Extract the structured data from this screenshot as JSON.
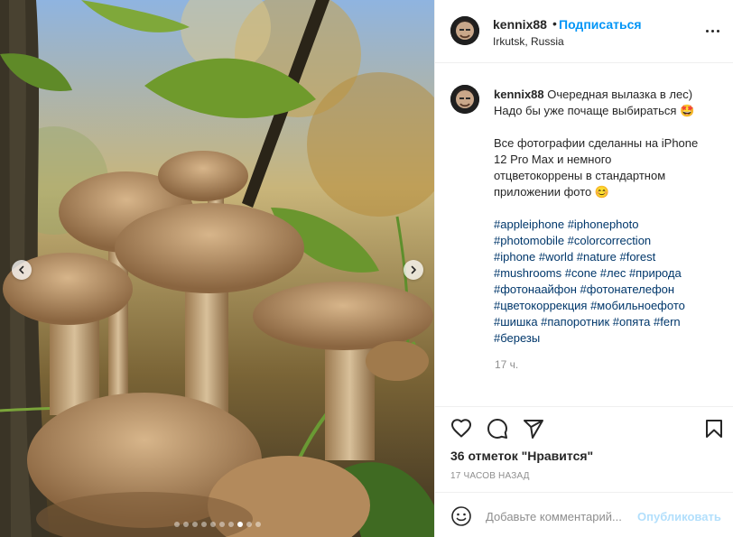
{
  "post": {
    "username": "kennix88",
    "separator": "•",
    "follow_label": "Подписаться",
    "location": "Irkutsk, Russia",
    "caption_lines": [
      {
        "text": "Очередная вылазка в лес)",
        "kind": "first"
      },
      {
        "text": "Надо бы уже почаще выбираться 🤩",
        "kind": "text"
      },
      {
        "text": "",
        "kind": "blank"
      },
      {
        "text": "Все фотографии сделанны на iPhone",
        "kind": "text"
      },
      {
        "text": "12 Pro Max и немного",
        "kind": "text"
      },
      {
        "text": "отцветокоррены в стандартном",
        "kind": "text"
      },
      {
        "text": "приложении фото 😊",
        "kind": "text"
      },
      {
        "text": "",
        "kind": "blank"
      },
      {
        "text": "#appleiphone #iphonephoto",
        "kind": "tags"
      },
      {
        "text": "#photomobile #colorcorrection",
        "kind": "tags"
      },
      {
        "text": "#iphone #world #nature #forest",
        "kind": "tags"
      },
      {
        "text": "#mushrooms #cone #лес #природа",
        "kind": "tags"
      },
      {
        "text": "#фотонаайфон #фотонателефон",
        "kind": "tags"
      },
      {
        "text": "#цветокоррекция #мобильноефото",
        "kind": "tags"
      },
      {
        "text": "#шишка #папоротник #опята #fern",
        "kind": "tags"
      },
      {
        "text": "#березы",
        "kind": "tags"
      }
    ],
    "comment_time": "17 ч.",
    "likes": "36 отметок \"Нравится\"",
    "posted_ago": "17 ЧАСОВ НАЗАД",
    "comment_placeholder": "Добавьте комментарий...",
    "publish_label": "Опубликовать"
  },
  "carousel": {
    "total_slides": 10,
    "active_slide": 8
  },
  "icons": {
    "more": "more-icon",
    "like": "heart-icon",
    "comment": "comment-icon",
    "share": "share-icon",
    "save": "bookmark-icon",
    "emoji": "emoji-icon",
    "prev": "chevron-left-icon",
    "next": "chevron-right-icon"
  },
  "colors": {
    "link_blue": "#0095f6",
    "hashtag": "#00376b",
    "muted": "#8e8e8e",
    "publish_disabled": "#b2dffc"
  }
}
